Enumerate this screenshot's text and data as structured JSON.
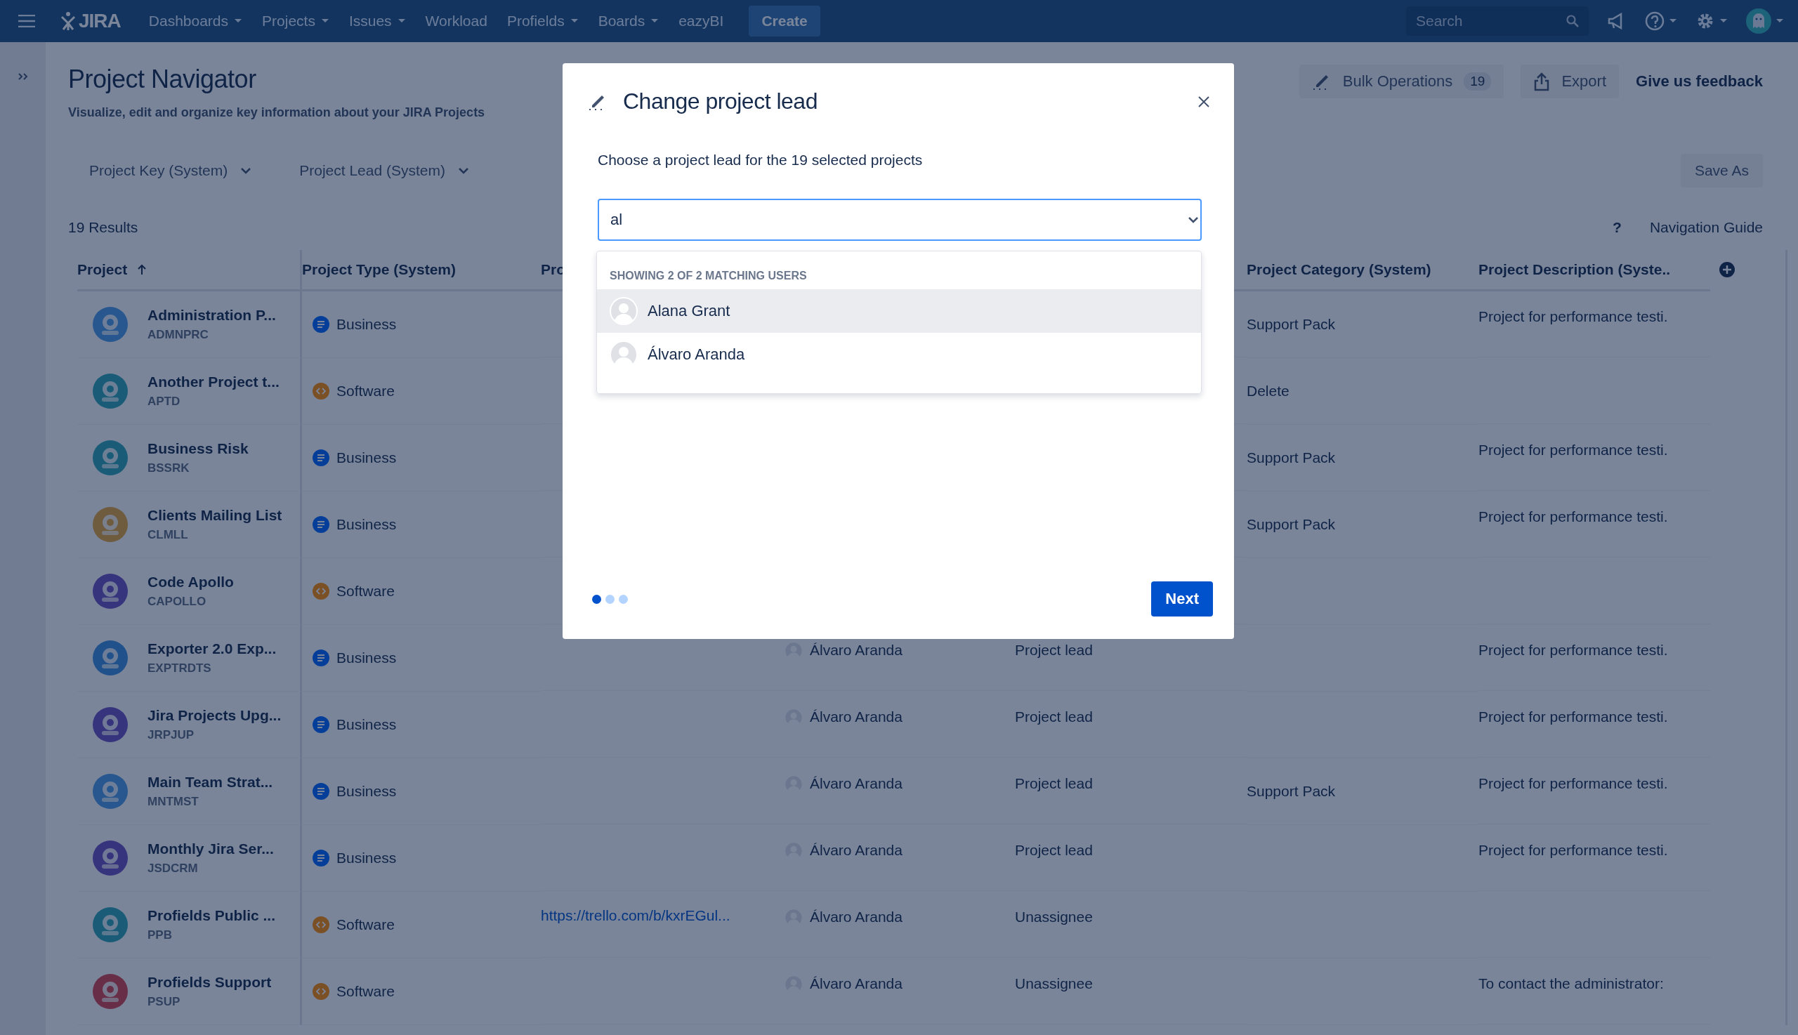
{
  "top_nav": {
    "logo": "JIRA",
    "menu": [
      {
        "label": "Dashboards",
        "dropdown": true
      },
      {
        "label": "Projects",
        "dropdown": true
      },
      {
        "label": "Issues",
        "dropdown": true
      },
      {
        "label": "Workload",
        "dropdown": false
      },
      {
        "label": "Profields",
        "dropdown": true
      },
      {
        "label": "Boards",
        "dropdown": true
      },
      {
        "label": "eazyBI",
        "dropdown": false
      }
    ],
    "create": "Create",
    "search": {
      "placeholder": "Search"
    }
  },
  "page": {
    "title": "Project Navigator",
    "subtitle": "Visualize, edit and organize key information about your JIRA Projects",
    "filters": [
      "Project Key (System)",
      "Project Lead (System)"
    ],
    "results": "19 Results",
    "bulk_operations": {
      "label": "Bulk Operations",
      "count": "19"
    },
    "export": "Export",
    "feedback": "Give us feedback",
    "save_as": "Save As",
    "help": "?",
    "navigation_guide": "Navigation Guide"
  },
  "table": {
    "header": {
      "project": {
        "label": "Project",
        "sorted": true
      },
      "type": "Project Type (System)",
      "column_3": "Pro",
      "category": "Project Category (System)",
      "description": "Project Description (Syste.."
    },
    "rows": [
      {
        "name": "Administration P...",
        "key": "ADMNPRC",
        "type": "Business",
        "kind": "business",
        "category": "Support Pack",
        "description": "Project for performance testi."
      },
      {
        "name": "Another Project t...",
        "key": "APTD",
        "type": "Software",
        "kind": "software",
        "category": "Delete"
      },
      {
        "name": "Business Risk",
        "key": "BSSRK",
        "type": "Business",
        "kind": "business",
        "category": "Support Pack",
        "description": "Project for performance testi."
      },
      {
        "name": "Clients Mailing List",
        "key": "CLMLL",
        "type": "Business",
        "kind": "business",
        "category": "Support Pack",
        "description": "Project for performance testi."
      },
      {
        "name": "Code Apollo",
        "key": "CAPOLLO",
        "type": "Software",
        "kind": "software"
      },
      {
        "name": "Exporter 2.0 Exp...",
        "key": "EXPTRDTS",
        "type": "Business",
        "kind": "business",
        "lead": "Álvaro Aranda",
        "role": "Project lead",
        "description": "Project for performance testi."
      },
      {
        "name": "Jira Projects Upg...",
        "key": "JRPJUP",
        "type": "Business",
        "kind": "business",
        "lead": "Álvaro Aranda",
        "role": "Project lead",
        "description": "Project for performance testi."
      },
      {
        "name": "Main Team Strat...",
        "key": "MNTMST",
        "type": "Business",
        "kind": "business",
        "lead": "Álvaro Aranda",
        "role": "Project lead",
        "category": "Support Pack",
        "description": "Project for performance testi."
      },
      {
        "name": "Monthly Jira Ser...",
        "key": "JSDCRM",
        "type": "Business",
        "kind": "business",
        "lead": "Álvaro Aranda",
        "role": "Project lead",
        "description": "Project for performance testi."
      },
      {
        "name": "Profields Public ...",
        "key": "PPB",
        "type": "Software",
        "kind": "software",
        "column_3": "https://trello.com/b/kxrEGul...",
        "lead": "Álvaro Aranda",
        "role": "Unassignee"
      },
      {
        "name": "Profields Support",
        "key": "PSUP",
        "type": "Software",
        "kind": "software",
        "lead": "Álvaro Aranda",
        "role": "Unassignee",
        "description": "To contact the administrator:"
      }
    ]
  },
  "modal": {
    "title": "Change project lead",
    "instruction": "Choose a project lead for the 19 selected projects",
    "input": {
      "value": "al"
    },
    "results_header": "SHOWING 2 OF 2 MATCHING USERS",
    "users": [
      {
        "name": "Alana Grant",
        "selected": true
      },
      {
        "name": "Álvaro Aranda",
        "selected": false
      }
    ],
    "steps": [
      {
        "selected": true
      },
      {
        "selected": false
      },
      {
        "selected": false
      }
    ],
    "next": "Next"
  }
}
